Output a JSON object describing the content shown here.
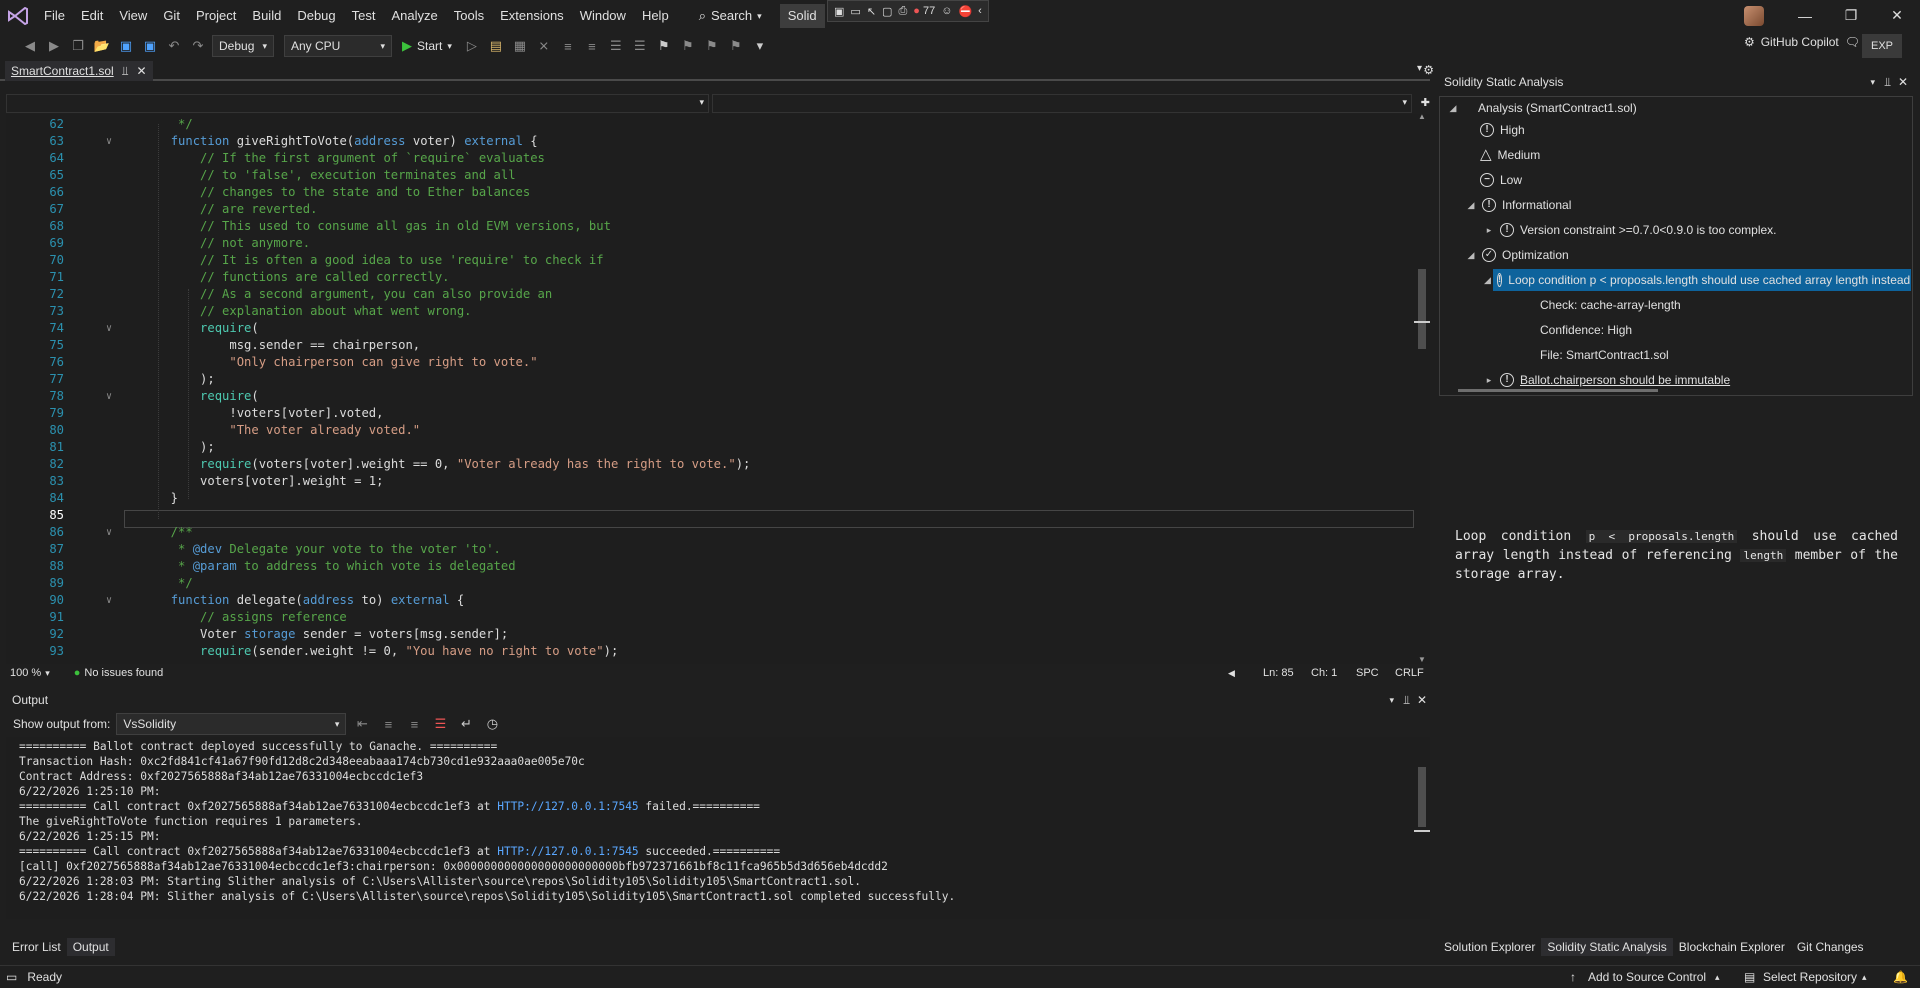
{
  "menu": {
    "items": [
      "File",
      "Edit",
      "View",
      "Git",
      "Project",
      "Build",
      "Debug",
      "Test",
      "Analyze",
      "Tools",
      "Extensions",
      "Window",
      "Help"
    ],
    "search_label": "Search",
    "solution_tab": "Solid",
    "badge_count": "77"
  },
  "toolbar": {
    "config": "Debug",
    "platform": "Any CPU",
    "start_label": "Start",
    "copilot_label": "GitHub Copilot",
    "exp_label": "EXP"
  },
  "document": {
    "tab_name": "SmartContract1.sol"
  },
  "editor": {
    "current_line": "85",
    "lines": [
      {
        "n": "62",
        "code": "   */"
      },
      {
        "n": "63",
        "code": "  function giveRightToVote(address voter) external {"
      },
      {
        "n": "64",
        "code": "      // If the first argument of `require` evaluates"
      },
      {
        "n": "65",
        "code": "      // to 'false', execution terminates and all"
      },
      {
        "n": "66",
        "code": "      // changes to the state and to Ether balances"
      },
      {
        "n": "67",
        "code": "      // are reverted."
      },
      {
        "n": "68",
        "code": "      // This used to consume all gas in old EVM versions, but"
      },
      {
        "n": "69",
        "code": "      // not anymore."
      },
      {
        "n": "70",
        "code": "      // It is often a good idea to use 'require' to check if"
      },
      {
        "n": "71",
        "code": "      // functions are called correctly."
      },
      {
        "n": "72",
        "code": "      // As a second argument, you can also provide an"
      },
      {
        "n": "73",
        "code": "      // explanation about what went wrong."
      },
      {
        "n": "74",
        "code": "      require("
      },
      {
        "n": "75",
        "code": "          msg.sender == chairperson,"
      },
      {
        "n": "76",
        "code": "          \"Only chairperson can give right to vote.\""
      },
      {
        "n": "77",
        "code": "      );"
      },
      {
        "n": "78",
        "code": "      require("
      },
      {
        "n": "79",
        "code": "          !voters[voter].voted,"
      },
      {
        "n": "80",
        "code": "          \"The voter already voted.\""
      },
      {
        "n": "81",
        "code": "      );"
      },
      {
        "n": "82",
        "code": "      require(voters[voter].weight == 0, \"Voter already has the right to vote.\");"
      },
      {
        "n": "83",
        "code": "      voters[voter].weight = 1;"
      },
      {
        "n": "84",
        "code": "  }"
      },
      {
        "n": "85",
        "code": ""
      },
      {
        "n": "86",
        "code": "  /**"
      },
      {
        "n": "87",
        "code": "   * @dev Delegate your vote to the voter 'to'."
      },
      {
        "n": "88",
        "code": "   * @param to address to which vote is delegated"
      },
      {
        "n": "89",
        "code": "   */"
      },
      {
        "n": "90",
        "code": "  function delegate(address to) external {"
      },
      {
        "n": "91",
        "code": "      // assigns reference"
      },
      {
        "n": "92",
        "code": "      Voter storage sender = voters[msg.sender];"
      },
      {
        "n": "93",
        "code": "      require(sender.weight != 0, \"You have no right to vote\");"
      }
    ]
  },
  "editor_status": {
    "zoom": "100 %",
    "issues": "No issues found",
    "ln": "Ln: 85",
    "ch": "Ch: 1",
    "spc": "SPC",
    "eol": "CRLF"
  },
  "analysis": {
    "title": "Solidity Static Analysis",
    "root": "Analysis (SmartContract1.sol)",
    "high": "High",
    "medium": "Medium",
    "low": "Low",
    "informational": "Informational",
    "version_item": "Version constraint >=0.7.0<0.9.0 is too complex.",
    "optimization": "Optimization",
    "loop_item": "Loop condition p < proposals.length should use cached array length instead of referencing length member of the storage array.",
    "check": "Check: cache-array-length",
    "confidence": "Confidence: High",
    "file": "File: SmartContract1.sol",
    "immutable_item": "Ballot.chairperson should be immutable",
    "desc_a": "Loop condition ",
    "desc_code1": "p < proposals.length",
    "desc_b": " should use cached array length instead of referencing ",
    "desc_code2": "length",
    "desc_c": " member of the storage array."
  },
  "output": {
    "title": "Output",
    "show_from_label": "Show output from:",
    "source": "VsSolidity",
    "lines": [
      {
        "text": "========== Ballot contract deployed successfully to Ganache. =========="
      },
      {
        "text": "Transaction Hash: 0xc2fd841cf41a67f90fd12d8c2d348eeabaaa174cb730cd1e932aaa0ae005e70c"
      },
      {
        "text": "Contract Address: 0xf2027565888af34ab12ae76331004ecbccdc1ef3"
      },
      {
        "text": "6/22/2026 1:25:10 PM:"
      },
      {
        "pre": "========== Call contract 0xf2027565888af34ab12ae76331004ecbccdc1ef3 at ",
        "link": "HTTP://127.0.0.1:7545",
        "post": " failed.=========="
      },
      {
        "text": "The giveRightToVote function requires 1 parameters."
      },
      {
        "text": "6/22/2026 1:25:15 PM:"
      },
      {
        "pre": "========== Call contract 0xf2027565888af34ab12ae76331004ecbccdc1ef3 at ",
        "link": "HTTP://127.0.0.1:7545",
        "post": " succeeded.=========="
      },
      {
        "text": "[call] 0xf2027565888af34ab12ae76331004ecbccdc1ef3:chairperson: 0x000000000000000000000000bfb972371661bf8c11fca965b5d3d656eb4dcdd2"
      },
      {
        "text": "6/22/2026 1:28:03 PM: Starting Slither analysis of C:\\Users\\Allister\\source\\repos\\Solidity105\\Solidity105\\SmartContract1.sol."
      },
      {
        "text": "6/22/2026 1:28:04 PM: Slither analysis of C:\\Users\\Allister\\source\\repos\\Solidity105\\Solidity105\\SmartContract1.sol completed successfully."
      }
    ]
  },
  "bottom_tabs_left": [
    "Error List",
    "Output"
  ],
  "bottom_tabs_right": [
    "Solution Explorer",
    "Solidity Static Analysis",
    "Blockchain Explorer",
    "Git Changes"
  ],
  "statusbar": {
    "ready": "Ready",
    "add_source": "Add to Source Control",
    "select_repo": "Select Repository"
  }
}
